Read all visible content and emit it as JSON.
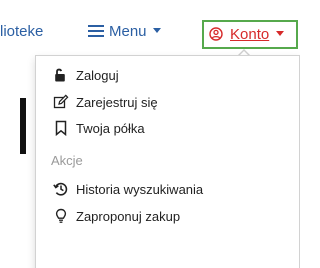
{
  "navbar": {
    "library_label": "lioteke",
    "menu_label": "Menu",
    "account_label": "Konto"
  },
  "dropdown": {
    "items": [
      {
        "label": "Zaloguj",
        "icon": "unlock-icon"
      },
      {
        "label": "Zarejestruj się",
        "icon": "edit-icon"
      },
      {
        "label": "Twoja półka",
        "icon": "bookmark-icon"
      }
    ],
    "section_label": "Akcje",
    "actions": [
      {
        "label": "Historia wyszukiwania",
        "icon": "history-icon"
      },
      {
        "label": "Zaproponuj zakup",
        "icon": "lightbulb-icon"
      }
    ]
  },
  "colors": {
    "link": "#2b5fa3",
    "account": "#d62a2a",
    "account_border": "#56a94c",
    "section_label": "#9a9a9a"
  }
}
